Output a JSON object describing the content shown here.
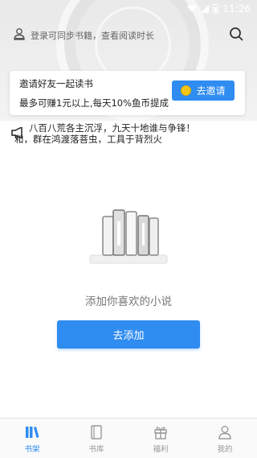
{
  "status_bar": {
    "time": "11:26"
  },
  "header": {
    "login_prompt": "登录可同步书籍，查看阅读时长"
  },
  "invite_card": {
    "title": "邀请好友一起读书",
    "description": "最多可赚1元以上,每天10%鱼币提成",
    "button_label": "去邀请"
  },
  "notice": {
    "line1": "八百八荒各主沉浮，九天十地谁与争锋！",
    "line2": "和，群在鸿渡落菩虫，工具于背烈火"
  },
  "empty_state": {
    "message": "添加你喜欢的小说",
    "button_label": "去添加"
  },
  "tabs": [
    {
      "label": "书架",
      "icon": "bookshelf-icon",
      "active": true
    },
    {
      "label": "书库",
      "icon": "library-icon",
      "active": false
    },
    {
      "label": "福利",
      "icon": "gift-icon",
      "active": false
    },
    {
      "label": "我的",
      "icon": "profile-icon",
      "active": false
    }
  ],
  "colors": {
    "accent": "#2f8cf1",
    "coin": "#f5c518",
    "inactive_tab": "#999999"
  }
}
